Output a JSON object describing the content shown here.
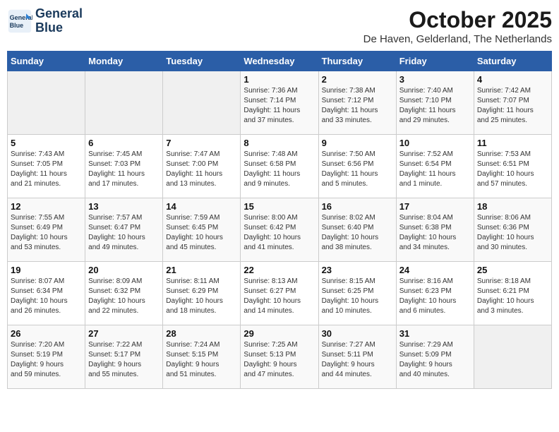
{
  "header": {
    "logo_line1": "General",
    "logo_line2": "Blue",
    "month": "October 2025",
    "location": "De Haven, Gelderland, The Netherlands"
  },
  "weekdays": [
    "Sunday",
    "Monday",
    "Tuesday",
    "Wednesday",
    "Thursday",
    "Friday",
    "Saturday"
  ],
  "weeks": [
    [
      {
        "day": "",
        "info": ""
      },
      {
        "day": "",
        "info": ""
      },
      {
        "day": "",
        "info": ""
      },
      {
        "day": "1",
        "info": "Sunrise: 7:36 AM\nSunset: 7:14 PM\nDaylight: 11 hours\nand 37 minutes."
      },
      {
        "day": "2",
        "info": "Sunrise: 7:38 AM\nSunset: 7:12 PM\nDaylight: 11 hours\nand 33 minutes."
      },
      {
        "day": "3",
        "info": "Sunrise: 7:40 AM\nSunset: 7:10 PM\nDaylight: 11 hours\nand 29 minutes."
      },
      {
        "day": "4",
        "info": "Sunrise: 7:42 AM\nSunset: 7:07 PM\nDaylight: 11 hours\nand 25 minutes."
      }
    ],
    [
      {
        "day": "5",
        "info": "Sunrise: 7:43 AM\nSunset: 7:05 PM\nDaylight: 11 hours\nand 21 minutes."
      },
      {
        "day": "6",
        "info": "Sunrise: 7:45 AM\nSunset: 7:03 PM\nDaylight: 11 hours\nand 17 minutes."
      },
      {
        "day": "7",
        "info": "Sunrise: 7:47 AM\nSunset: 7:00 PM\nDaylight: 11 hours\nand 13 minutes."
      },
      {
        "day": "8",
        "info": "Sunrise: 7:48 AM\nSunset: 6:58 PM\nDaylight: 11 hours\nand 9 minutes."
      },
      {
        "day": "9",
        "info": "Sunrise: 7:50 AM\nSunset: 6:56 PM\nDaylight: 11 hours\nand 5 minutes."
      },
      {
        "day": "10",
        "info": "Sunrise: 7:52 AM\nSunset: 6:54 PM\nDaylight: 11 hours\nand 1 minute."
      },
      {
        "day": "11",
        "info": "Sunrise: 7:53 AM\nSunset: 6:51 PM\nDaylight: 10 hours\nand 57 minutes."
      }
    ],
    [
      {
        "day": "12",
        "info": "Sunrise: 7:55 AM\nSunset: 6:49 PM\nDaylight: 10 hours\nand 53 minutes."
      },
      {
        "day": "13",
        "info": "Sunrise: 7:57 AM\nSunset: 6:47 PM\nDaylight: 10 hours\nand 49 minutes."
      },
      {
        "day": "14",
        "info": "Sunrise: 7:59 AM\nSunset: 6:45 PM\nDaylight: 10 hours\nand 45 minutes."
      },
      {
        "day": "15",
        "info": "Sunrise: 8:00 AM\nSunset: 6:42 PM\nDaylight: 10 hours\nand 41 minutes."
      },
      {
        "day": "16",
        "info": "Sunrise: 8:02 AM\nSunset: 6:40 PM\nDaylight: 10 hours\nand 38 minutes."
      },
      {
        "day": "17",
        "info": "Sunrise: 8:04 AM\nSunset: 6:38 PM\nDaylight: 10 hours\nand 34 minutes."
      },
      {
        "day": "18",
        "info": "Sunrise: 8:06 AM\nSunset: 6:36 PM\nDaylight: 10 hours\nand 30 minutes."
      }
    ],
    [
      {
        "day": "19",
        "info": "Sunrise: 8:07 AM\nSunset: 6:34 PM\nDaylight: 10 hours\nand 26 minutes."
      },
      {
        "day": "20",
        "info": "Sunrise: 8:09 AM\nSunset: 6:32 PM\nDaylight: 10 hours\nand 22 minutes."
      },
      {
        "day": "21",
        "info": "Sunrise: 8:11 AM\nSunset: 6:29 PM\nDaylight: 10 hours\nand 18 minutes."
      },
      {
        "day": "22",
        "info": "Sunrise: 8:13 AM\nSunset: 6:27 PM\nDaylight: 10 hours\nand 14 minutes."
      },
      {
        "day": "23",
        "info": "Sunrise: 8:15 AM\nSunset: 6:25 PM\nDaylight: 10 hours\nand 10 minutes."
      },
      {
        "day": "24",
        "info": "Sunrise: 8:16 AM\nSunset: 6:23 PM\nDaylight: 10 hours\nand 6 minutes."
      },
      {
        "day": "25",
        "info": "Sunrise: 8:18 AM\nSunset: 6:21 PM\nDaylight: 10 hours\nand 3 minutes."
      }
    ],
    [
      {
        "day": "26",
        "info": "Sunrise: 7:20 AM\nSunset: 5:19 PM\nDaylight: 9 hours\nand 59 minutes."
      },
      {
        "day": "27",
        "info": "Sunrise: 7:22 AM\nSunset: 5:17 PM\nDaylight: 9 hours\nand 55 minutes."
      },
      {
        "day": "28",
        "info": "Sunrise: 7:24 AM\nSunset: 5:15 PM\nDaylight: 9 hours\nand 51 minutes."
      },
      {
        "day": "29",
        "info": "Sunrise: 7:25 AM\nSunset: 5:13 PM\nDaylight: 9 hours\nand 47 minutes."
      },
      {
        "day": "30",
        "info": "Sunrise: 7:27 AM\nSunset: 5:11 PM\nDaylight: 9 hours\nand 44 minutes."
      },
      {
        "day": "31",
        "info": "Sunrise: 7:29 AM\nSunset: 5:09 PM\nDaylight: 9 hours\nand 40 minutes."
      },
      {
        "day": "",
        "info": ""
      }
    ]
  ]
}
